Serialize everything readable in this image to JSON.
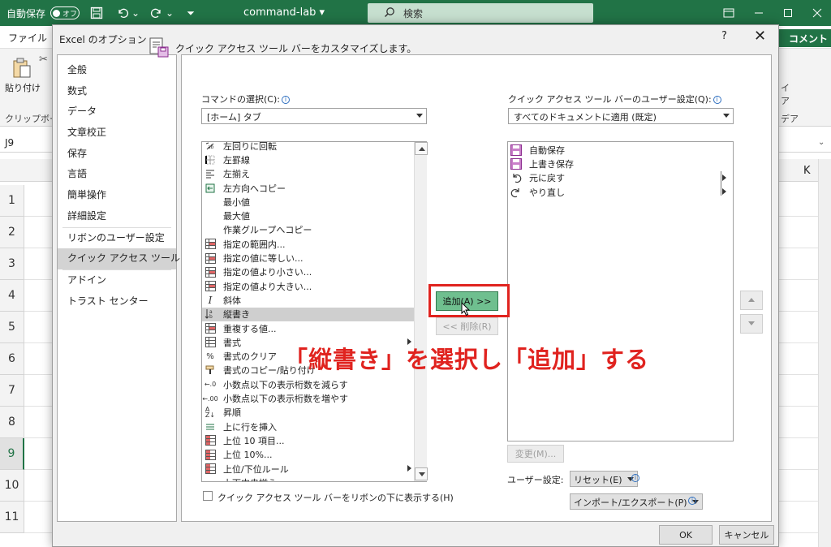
{
  "excel": {
    "autosave_label": "自動保存",
    "autosave_state": "オフ",
    "workbook_name": "command-lab",
    "search_placeholder": "検索",
    "file_tab": "ファイル",
    "comment_button": "コメント",
    "paste_label": "貼り付け",
    "clipboard_label": "クリップボード",
    "name_box": "J9",
    "column_k": "K",
    "ribbon_right_1": "イ",
    "ribbon_right_2": "ア",
    "ribbon_right_3": "デア",
    "row_numbers": [
      "1",
      "2",
      "3",
      "4",
      "5",
      "6",
      "7",
      "8",
      "9",
      "10",
      "11"
    ],
    "selected_row": "9",
    "accent_color": "#217346"
  },
  "dialog": {
    "title": "Excel のオプション",
    "help": "?",
    "close": "✕",
    "nav": [
      "全般",
      "数式",
      "データ",
      "文章校正",
      "保存",
      "言語",
      "簡単操作",
      "詳細設定",
      "リボンのユーザー設定",
      "クイック アクセス ツール バー",
      "アドイン",
      "トラスト センター"
    ],
    "active_nav": "クイック アクセス ツール バー",
    "header": "クイック アクセス ツール バーをカスタマイズします。",
    "choose_commands_label": "コマンドの選択(C):",
    "choose_commands_value": "[ホーム] タブ",
    "customize_label": "クイック アクセス ツール バーのユーザー設定(Q):",
    "customize_value": "すべてのドキュメントに適用 (既定)",
    "commands": [
      {
        "label": "左回りに回転",
        "icon": "rotate-left-icon"
      },
      {
        "label": "左罫線",
        "icon": "border-left-icon"
      },
      {
        "label": "左揃え",
        "icon": "align-left-icon"
      },
      {
        "label": "左方向へコピー",
        "icon": "fill-left-icon"
      },
      {
        "label": "最小値",
        "icon": ""
      },
      {
        "label": "最大値",
        "icon": ""
      },
      {
        "label": "作業グループへコピー",
        "icon": ""
      },
      {
        "label": "指定の範囲内...",
        "icon": "highlight-rule-icon"
      },
      {
        "label": "指定の値に等しい...",
        "icon": "highlight-rule-icon"
      },
      {
        "label": "指定の値より小さい...",
        "icon": "highlight-rule-icon"
      },
      {
        "label": "指定の値より大きい...",
        "icon": "highlight-rule-icon"
      },
      {
        "label": "斜体",
        "icon": "italic-icon"
      },
      {
        "label": "縦書き",
        "icon": "vertical-text-icon",
        "selected": true
      },
      {
        "label": "重複する値...",
        "icon": "highlight-rule-icon"
      },
      {
        "label": "書式",
        "icon": "format-icon",
        "submenu": true
      },
      {
        "label": "書式のクリア",
        "icon": "clear-format-icon"
      },
      {
        "label": "書式のコピー/貼り付け",
        "icon": "format-painter-icon"
      },
      {
        "label": "小数点以下の表示桁数を減らす",
        "icon": "decrease-decimal-icon"
      },
      {
        "label": "小数点以下の表示桁数を増やす",
        "icon": "increase-decimal-icon"
      },
      {
        "label": "昇順",
        "icon": "sort-ascending-icon"
      },
      {
        "label": "上に行を挿入",
        "icon": "insert-row-icon"
      },
      {
        "label": "上位 10 項目...",
        "icon": "top-rule-icon"
      },
      {
        "label": "上位 10%...",
        "icon": "top-rule-icon"
      },
      {
        "label": "上位/下位ルール",
        "icon": "top-rule-icon",
        "submenu": true
      },
      {
        "label": "上下中央揃え",
        "icon": "align-middle-icon"
      }
    ],
    "toolbar_items": [
      {
        "label": "自動保存",
        "icon": "autosave-icon"
      },
      {
        "label": "上書き保存",
        "icon": "save-icon"
      },
      {
        "label": "元に戻す",
        "icon": "undo-icon",
        "submenu": true
      },
      {
        "label": "やり直し",
        "icon": "redo-icon",
        "submenu": true
      }
    ],
    "add_button": "追加(A) >>",
    "remove_button": "<< 削除(R)",
    "modify_button": "変更(M)...",
    "user_settings_label": "ユーザー設定:",
    "reset_button": "リセット(E)",
    "import_export_button": "インポート/エクスポート(P)",
    "show_below_ribbon": "クイック アクセス ツール バーをリボンの下に表示する(H)",
    "ok_button": "OK",
    "cancel_button": "キャンセル",
    "annotation": "「縦書き」を選択し「追加」する",
    "annotation_color": "#e0231f"
  }
}
